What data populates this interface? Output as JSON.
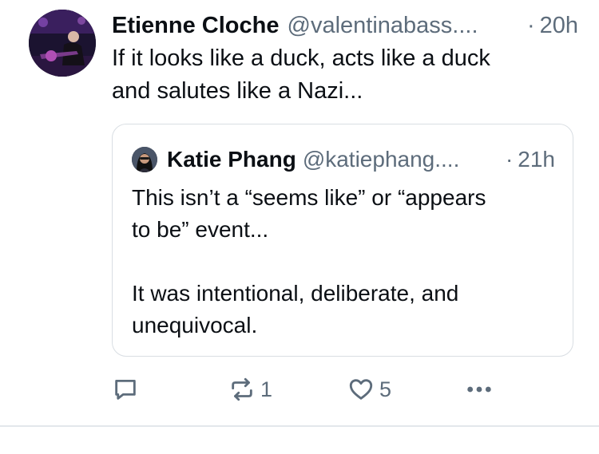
{
  "post": {
    "author": {
      "display_name": "Etienne Cloche",
      "handle": "@valentinabass....",
      "avatar_icon": "avatar-photo-bassist"
    },
    "separator": "·",
    "time": "20h",
    "text": "If it looks like a duck, acts like a duck\nand salutes like a Nazi..."
  },
  "quote": {
    "author": {
      "display_name": "Katie Phang",
      "handle": "@katiephang....",
      "avatar_icon": "avatar-photo-woman"
    },
    "separator": "·",
    "time": "21h",
    "text": "This isn’t a “seems like” or “appears\nto be” event...\n\nIt was intentional, deliberate, and\nunequivocal."
  },
  "actions": {
    "reply": {
      "icon": "speech-bubble-icon",
      "count": ""
    },
    "repost": {
      "icon": "repost-arrows-icon",
      "count": "1"
    },
    "like": {
      "icon": "heart-icon",
      "count": "5"
    },
    "more": {
      "icon": "ellipsis-icon"
    }
  },
  "colors": {
    "text": "#0b0f14",
    "muted": "#5d6c7b",
    "border": "#d9dee3"
  }
}
